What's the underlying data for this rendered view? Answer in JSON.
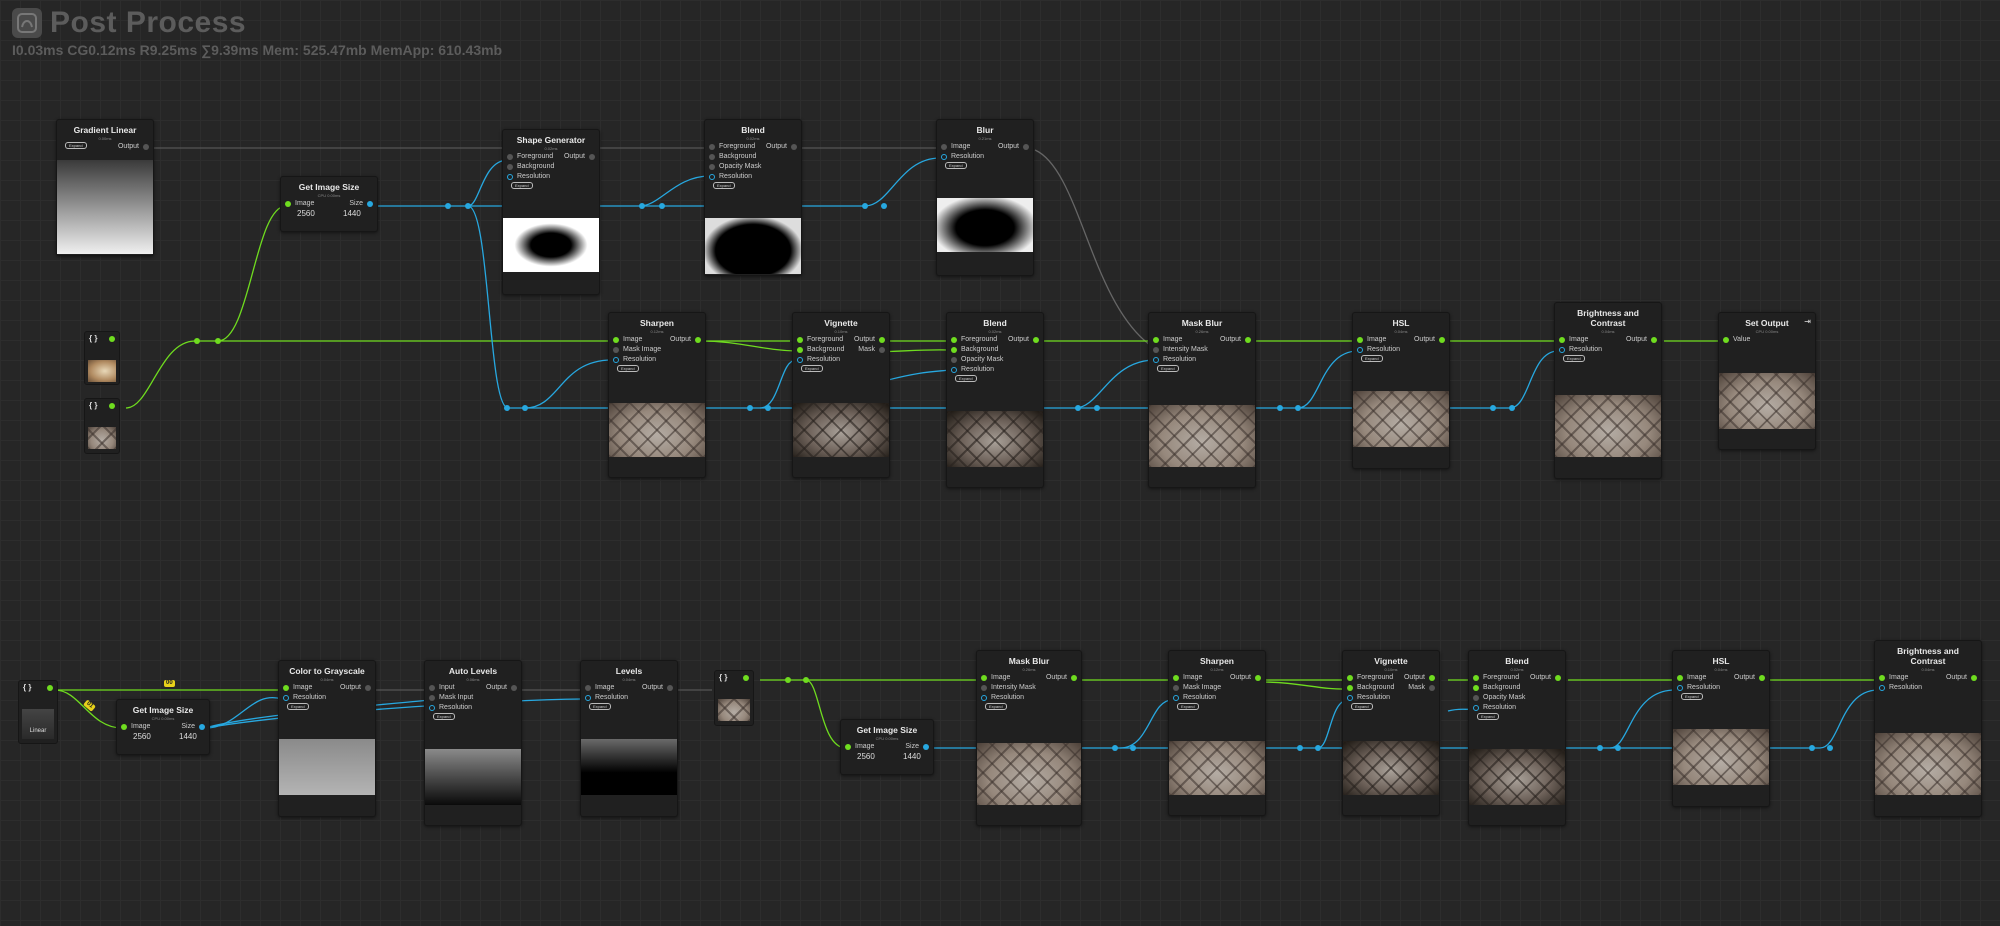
{
  "app": {
    "title": "Post Process",
    "stats": "I0.03ms CG0.12ms R9.25ms ∑9.39ms Mem: 525.47mb MemApp: 610.43mb"
  },
  "common": {
    "image": "Image",
    "output": "Output",
    "size": "Size",
    "foreground": "Foreground",
    "background": "Background",
    "opacity_mask": "Opacity Mask",
    "resolution": "Resolution",
    "mask_image": "Mask Image",
    "mask": "Mask",
    "intensity_mask": "Intensity Mask",
    "input": "Input",
    "mask_input": "Mask Input",
    "value": "Value",
    "expand": "Expand",
    "width": "2560",
    "height": "1440"
  },
  "nodes": {
    "gradient_linear": {
      "title": "Gradient Linear",
      "sub": "0.00ms"
    },
    "get_image_size_top": {
      "title": "Get Image Size",
      "sub": "CPU 0.00ms"
    },
    "shape_generator": {
      "title": "Shape Generator",
      "sub": "0.02ms"
    },
    "blend_top": {
      "title": "Blend",
      "sub": "0.02ms"
    },
    "blur_top": {
      "title": "Blur",
      "sub": "0.21ms"
    },
    "sharpen_top": {
      "title": "Sharpen",
      "sub": "0.12ms"
    },
    "vignette_top": {
      "title": "Vignette",
      "sub": "0.10ms"
    },
    "blend_mid": {
      "title": "Blend",
      "sub": "0.02ms"
    },
    "mask_blur_top": {
      "title": "Mask Blur",
      "sub": "0.26ms"
    },
    "hsl_top": {
      "title": "HSL",
      "sub": "0.04ms"
    },
    "bc_top": {
      "title": "Brightness and Contrast",
      "sub": "0.04ms"
    },
    "set_output": {
      "title": "Set Output",
      "sub": "CPU 0.00ms"
    },
    "var_linear": {
      "label": "Linear"
    },
    "get_image_size_b1": {
      "title": "Get Image Size",
      "sub": "CPU 0.00ms"
    },
    "color_to_grayscale": {
      "title": "Color to Grayscale",
      "sub": "0.04ms"
    },
    "auto_levels": {
      "title": "Auto Levels",
      "sub": "0.06ms"
    },
    "levels": {
      "title": "Levels",
      "sub": "0.04ms"
    },
    "get_image_size_b2": {
      "title": "Get Image Size",
      "sub": "CPU 0.00ms"
    },
    "mask_blur_b": {
      "title": "Mask Blur",
      "sub": "0.26ms"
    },
    "sharpen_b": {
      "title": "Sharpen",
      "sub": "0.12ms"
    },
    "vignette_b": {
      "title": "Vignette",
      "sub": "0.10ms"
    },
    "blend_b": {
      "title": "Blend",
      "sub": "0.02ms"
    },
    "hsl_b": {
      "title": "HSL",
      "sub": "0.04ms"
    },
    "bc_b": {
      "title": "Brightness and Contrast",
      "sub": "0.04ms"
    }
  },
  "badges": [
    "00",
    "01"
  ],
  "colors": {
    "image_pin": "#6fdc1f",
    "size_pin": "#27a8e0",
    "canvas": "#262626",
    "node": "#202020"
  }
}
